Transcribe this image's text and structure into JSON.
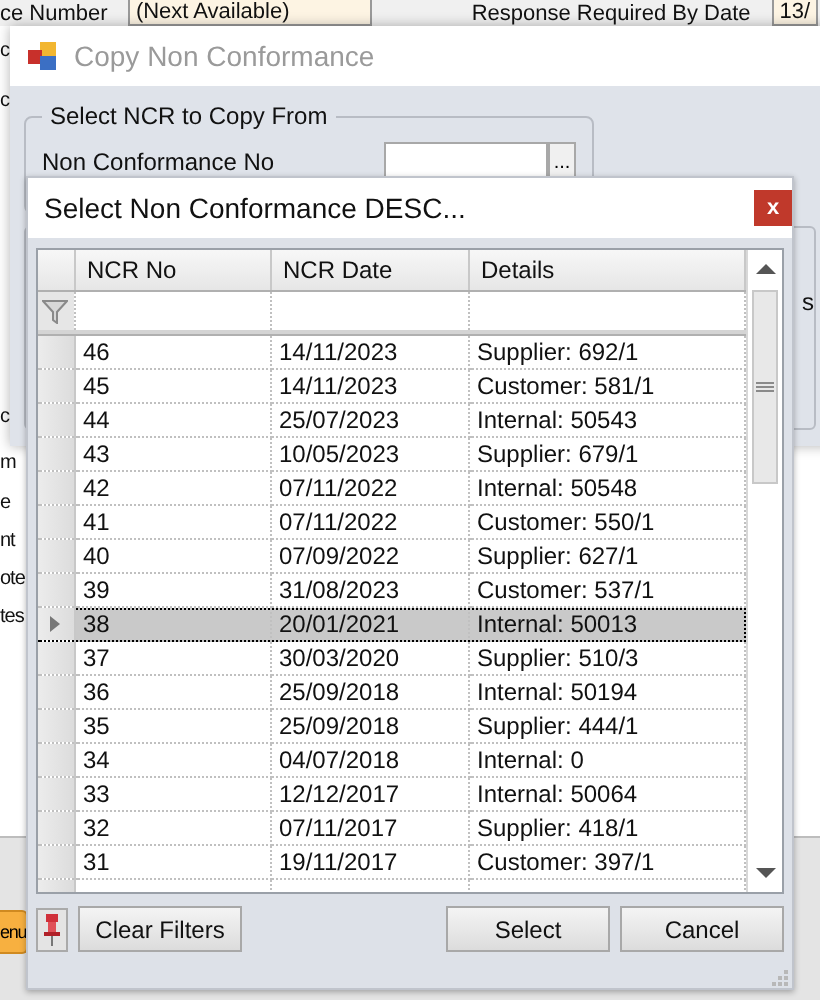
{
  "background_form": {
    "top_fields": [
      {
        "kind": "label",
        "text": "ce Number"
      },
      {
        "kind": "field",
        "text": "(Next Available)"
      },
      {
        "kind": "label",
        "text": "Response Required By Date"
      },
      {
        "kind": "field",
        "text": "13/"
      }
    ],
    "side_labels": [
      "c",
      "c",
      "c",
      "m",
      "e",
      "nt",
      "ote",
      "tes"
    ],
    "menu_button": "enu"
  },
  "copy_dialog": {
    "title": "Copy Non Conformance",
    "group_title": "Select NCR to Copy From",
    "field_label": "Non Conformance No",
    "browse_button": "...",
    "panel_text": "s"
  },
  "select_dialog": {
    "title": "Select Non Conformance DESC...",
    "close": "x",
    "table": {
      "columns": [
        "NCR No",
        "NCR Date",
        "Details"
      ],
      "rows": [
        {
          "ncr_no": "46",
          "ncr_date": "14/11/2023",
          "details": "Supplier: 692/1",
          "selected": false
        },
        {
          "ncr_no": "45",
          "ncr_date": "14/11/2023",
          "details": "Customer: 581/1",
          "selected": false
        },
        {
          "ncr_no": "44",
          "ncr_date": "25/07/2023",
          "details": "Internal: 50543",
          "selected": false
        },
        {
          "ncr_no": "43",
          "ncr_date": "10/05/2023",
          "details": "Supplier: 679/1",
          "selected": false
        },
        {
          "ncr_no": "42",
          "ncr_date": "07/11/2022",
          "details": "Internal: 50548",
          "selected": false
        },
        {
          "ncr_no": "41",
          "ncr_date": "07/11/2022",
          "details": "Customer: 550/1",
          "selected": false
        },
        {
          "ncr_no": "40",
          "ncr_date": "07/09/2022",
          "details": "Supplier: 627/1",
          "selected": false
        },
        {
          "ncr_no": "39",
          "ncr_date": "31/08/2023",
          "details": "Customer: 537/1",
          "selected": false
        },
        {
          "ncr_no": "38",
          "ncr_date": "20/01/2021",
          "details": "Internal: 50013",
          "selected": true
        },
        {
          "ncr_no": "37",
          "ncr_date": "30/03/2020",
          "details": "Supplier: 510/3",
          "selected": false
        },
        {
          "ncr_no": "36",
          "ncr_date": "25/09/2018",
          "details": "Internal: 50194",
          "selected": false
        },
        {
          "ncr_no": "35",
          "ncr_date": "25/09/2018",
          "details": "Supplier: 444/1",
          "selected": false
        },
        {
          "ncr_no": "34",
          "ncr_date": "04/07/2018",
          "details": "Internal: 0",
          "selected": false
        },
        {
          "ncr_no": "33",
          "ncr_date": "12/12/2017",
          "details": "Internal: 50064",
          "selected": false
        },
        {
          "ncr_no": "32",
          "ncr_date": "07/11/2017",
          "details": "Supplier: 418/1",
          "selected": false
        },
        {
          "ncr_no": "31",
          "ncr_date": "19/11/2017",
          "details": "Customer: 397/1",
          "selected": false
        }
      ]
    },
    "buttons": {
      "left": "Clear Filters",
      "ok": "Select",
      "cancel": "Cancel"
    }
  }
}
